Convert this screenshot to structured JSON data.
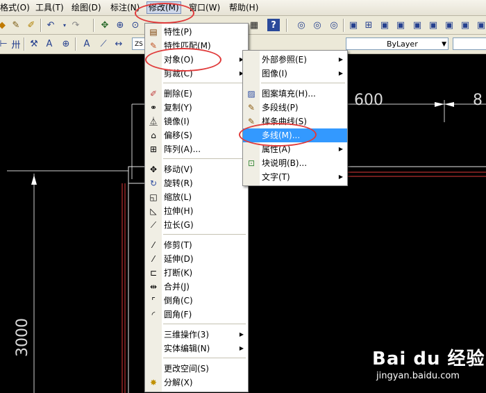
{
  "menubar": {
    "items": [
      {
        "label": "格式(O)"
      },
      {
        "label": "工具(T)"
      },
      {
        "label": "绘图(D)"
      },
      {
        "label": "标注(N)"
      },
      {
        "label": "修改(M)"
      },
      {
        "label": "窗口(W)"
      },
      {
        "label": "帮助(H)"
      }
    ]
  },
  "toolbar": {
    "style_partial": "ZS",
    "layer_combo_value": "ByLayer"
  },
  "modify_menu": {
    "items": [
      {
        "label": "特性(P)",
        "icon": "properties-icon"
      },
      {
        "label": "特性匹配(M)",
        "icon": "match-properties-icon"
      },
      {
        "label": "对象(O)",
        "submenu": true
      },
      {
        "label": "剪裁(C)",
        "submenu": true
      },
      {
        "label": "删除(E)",
        "icon": "erase-icon"
      },
      {
        "label": "复制(Y)",
        "icon": "copy-icon"
      },
      {
        "label": "镜像(I)",
        "icon": "mirror-icon"
      },
      {
        "label": "偏移(S)",
        "icon": "offset-icon"
      },
      {
        "label": "阵列(A)...",
        "icon": "array-icon"
      },
      {
        "label": "移动(V)",
        "icon": "move-icon"
      },
      {
        "label": "旋转(R)",
        "icon": "rotate-icon"
      },
      {
        "label": "缩放(L)",
        "icon": "scale-icon"
      },
      {
        "label": "拉伸(H)",
        "icon": "stretch-icon"
      },
      {
        "label": "拉长(G)",
        "icon": "lengthen-icon"
      },
      {
        "label": "修剪(T)",
        "icon": "trim-icon"
      },
      {
        "label": "延伸(D)",
        "icon": "extend-icon"
      },
      {
        "label": "打断(K)",
        "icon": "break-icon"
      },
      {
        "label": "合并(J)",
        "icon": "join-icon"
      },
      {
        "label": "倒角(C)",
        "icon": "chamfer-icon"
      },
      {
        "label": "圆角(F)",
        "icon": "fillet-icon"
      },
      {
        "label": "三维操作(3)",
        "submenu": true
      },
      {
        "label": "实体编辑(N)",
        "submenu": true
      },
      {
        "label": "更改空间(S)"
      },
      {
        "label": "分解(X)",
        "icon": "explode-icon"
      }
    ]
  },
  "object_submenu": {
    "items": [
      {
        "label": "外部参照(E)",
        "submenu": true
      },
      {
        "label": "图像(I)",
        "submenu": true
      },
      {
        "label": "图案填充(H)...",
        "icon": "hatch-icon"
      },
      {
        "label": "多段线(P)",
        "icon": "polyline-icon"
      },
      {
        "label": "样条曲线(S)",
        "icon": "spline-icon"
      },
      {
        "label": "多线(M)...",
        "highlighted": true
      },
      {
        "label": "属性(A)",
        "submenu": true
      },
      {
        "label": "块说明(B)...",
        "icon": "block-description-icon"
      },
      {
        "label": "文字(T)",
        "submenu": true
      }
    ]
  },
  "drawing": {
    "dim_top_1": "600",
    "dim_top_2": "8",
    "dim_vertical": "3000"
  },
  "watermark": {
    "brand": "Bai du 经验",
    "url": "jingyan.baidu.com"
  },
  "colors": {
    "highlight": "#3399ff",
    "annotation_red": "#e03a3a",
    "canvas": "#000000"
  }
}
